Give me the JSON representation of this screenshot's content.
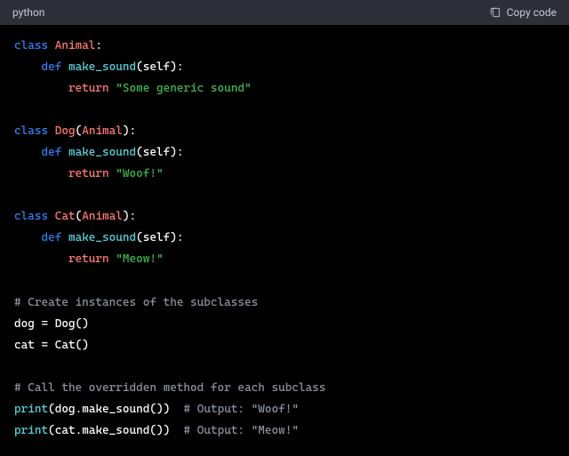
{
  "header": {
    "language": "python",
    "copy_label": "Copy code"
  },
  "code": {
    "class_kw": "class",
    "def_kw": "def",
    "return_kw": "return",
    "self_kw": "self",
    "print_fn": "print",
    "animal_cls": "Animal",
    "dog_cls": "Dog",
    "cat_cls": "Cat",
    "make_sound_fn": "make_sound",
    "generic_str": "\"Some generic sound\"",
    "woof_str": "\"Woof!\"",
    "meow_str": "\"Meow!\"",
    "dog_var": "dog",
    "cat_var": "cat",
    "comment1": "# Create instances of the subclasses",
    "comment2": "# Call the overridden method for each subclass",
    "comment_woof": "# Output: \"Woof!\"",
    "comment_meow": "# Output: \"Meow!\"",
    "eq": " = ",
    "colon": ":",
    "lparen": "(",
    "rparen": ")",
    "dot": "."
  }
}
